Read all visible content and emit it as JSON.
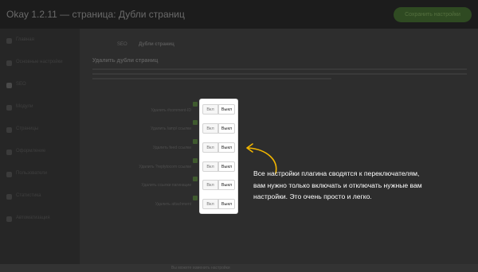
{
  "app": {
    "title": "Okay 1.2.11 — страница: Дубли страниц",
    "save_label": "Сохранить настройки"
  },
  "sidebar": {
    "items": [
      {
        "label": "Главная"
      },
      {
        "label": "Основные настройки"
      },
      {
        "label": "SEO"
      },
      {
        "label": "Модули"
      },
      {
        "label": "Страницы"
      },
      {
        "label": "Оформление"
      },
      {
        "label": "Пользователи"
      },
      {
        "label": "Статистика"
      },
      {
        "label": "Автоматизация"
      }
    ]
  },
  "breadcrumb": {
    "parent": "SEO",
    "current": "Дубли страниц"
  },
  "section": {
    "title": "Удалить дубли страниц"
  },
  "settings": [
    {
      "label": "Удалить #comment-ID",
      "on": "Вкл",
      "off": "Выкл"
    },
    {
      "label": "Удалить /amp/ ссылки",
      "on": "Вкл",
      "off": "Выкл"
    },
    {
      "label": "Удалить feed ссылки",
      "on": "Вкл",
      "off": "Выкл"
    },
    {
      "label": "Удалить ?replytocom ссылки",
      "on": "Вкл",
      "off": "Выкл"
    },
    {
      "label": "Удалить ссылки пагинации",
      "on": "Вкл",
      "off": "Выкл"
    },
    {
      "label": "Удалить attachment",
      "on": "Вкл",
      "off": "Выкл"
    }
  ],
  "footer": {
    "left": "",
    "center": "Вы можете изменить настройки"
  },
  "callout": {
    "text": "Все настройки плагина сводятся к переключателям, вам нужно только включать и отключать нужные вам настройки. Это очень просто и легко."
  },
  "colors": {
    "overlay": "#2b2b2b",
    "accent_green": "#3f5a2e",
    "arrow": "#f2b600"
  }
}
